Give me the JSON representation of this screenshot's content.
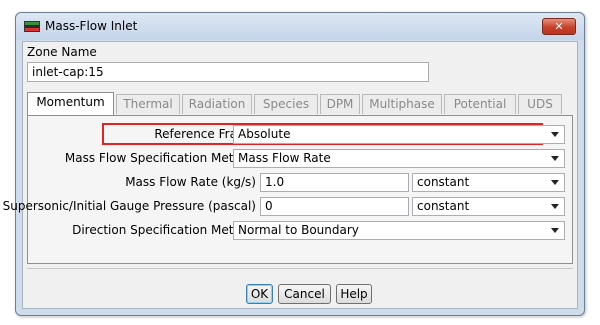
{
  "window": {
    "title": "Mass-Flow Inlet",
    "close_label": "✕"
  },
  "zone": {
    "label": "Zone Name",
    "value": "inlet-cap:15"
  },
  "tabs": [
    "Momentum",
    "Thermal",
    "Radiation",
    "Species",
    "DPM",
    "Multiphase",
    "Potential",
    "UDS"
  ],
  "active_tab": "Momentum",
  "momentum": {
    "reference_frame": {
      "label": "Reference Frame",
      "value": "Absolute"
    },
    "mass_flow_spec": {
      "label": "Mass Flow Specification Method",
      "value": "Mass Flow Rate"
    },
    "mass_flow_rate": {
      "label": "Mass Flow Rate (kg/s)",
      "value": "1.0",
      "profile": "constant"
    },
    "gauge_pressure": {
      "label": "Supersonic/Initial Gauge Pressure (pascal)",
      "value": "0",
      "profile": "constant"
    },
    "direction_spec": {
      "label": "Direction Specification Method",
      "value": "Normal to Boundary"
    }
  },
  "buttons": {
    "ok": "OK",
    "cancel": "Cancel",
    "help": "Help"
  },
  "colors": {
    "highlight": "#e02424",
    "titlebar": "#c4d5ea",
    "close": "#c8412a"
  }
}
